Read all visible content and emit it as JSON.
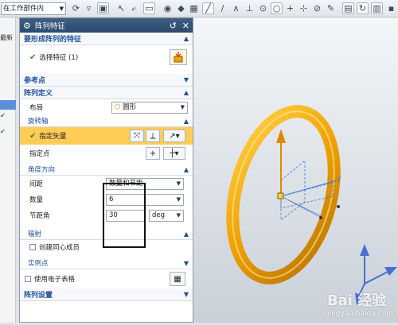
{
  "toolbar": {
    "scope_select": "在工作部件内",
    "icons": [
      "snap-icon",
      "select-filter-icon",
      "arrow-icon",
      "box-select-icon",
      "view-icon",
      "cube-icon",
      "line-icon",
      "curve-icon",
      "point-icon",
      "circle-icon",
      "plus-icon",
      "pencil-icon",
      "refresh-icon",
      "window-icon"
    ]
  },
  "left_strip": {
    "items": [
      "最新",
      "",
      "",
      ""
    ]
  },
  "dialog": {
    "title": "阵列特征",
    "select_features": {
      "header": "要形成阵列的特征",
      "selected": "选择特征 (1)"
    },
    "reference_point": {
      "header": "参考点"
    },
    "array_definition": {
      "header": "阵列定义",
      "layout_label": "布局",
      "layout_value": "圆形",
      "rotation_axis": {
        "header": "旋转轴",
        "specify_vector": "指定矢量",
        "specify_point": "指定点"
      },
      "angular_direction": {
        "header": "角度方向",
        "spacing_label": "间距",
        "spacing_value": "数量和节距",
        "count_label": "数量",
        "count_value": "6",
        "pitch_label": "节距角",
        "pitch_value": "30",
        "pitch_unit": "deg"
      },
      "radiate": {
        "header": "辐射",
        "create_concentric": "创建同心成员"
      },
      "instance_points": {
        "header": "实例点",
        "use_spreadsheet": "使用电子表格"
      }
    },
    "array_settings": {
      "header": "阵列设置"
    }
  },
  "viewport": {
    "axis_label": "Y",
    "ring_color": "#f0a000",
    "watermark": "Bai 经验",
    "watermark_sub": "jingyan.baidu.com"
  }
}
